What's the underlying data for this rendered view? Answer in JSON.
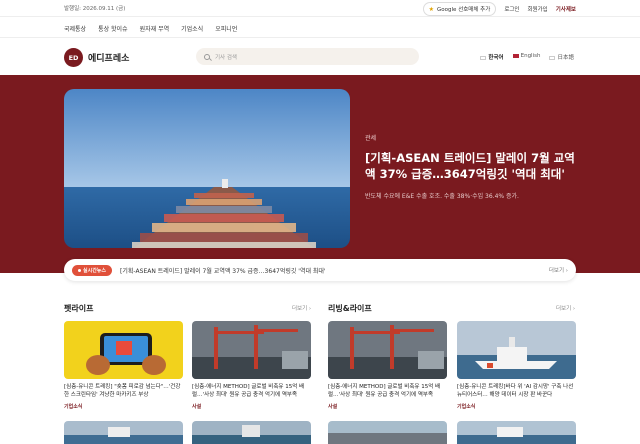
{
  "topbar": {
    "date": "발행일: 2026.09.11 (금)",
    "google_pref": "Google 선호매체 추가",
    "login": "로그인",
    "signup": "회원가입",
    "report": "기사제보"
  },
  "category_nav": [
    "국제통상",
    "통상 핫이슈",
    "원자재 무역",
    "기업소식",
    "오피니언"
  ],
  "header": {
    "logo_mark": "ED",
    "logo_name": "에디프레소",
    "search_placeholder": "기사 검색",
    "languages": [
      "한국어",
      "English",
      "日本語"
    ]
  },
  "hero": {
    "category": "관세",
    "title": "[기획-ASEAN 트레이드] 말레이 7월 교역액 37% 급증…3647억링깃 '역대 최대'",
    "summary": "반도체 수요에 E&E 수출 호조. 수출 38%·수입 36.4% 증가."
  },
  "breaking": {
    "badge": "실시간뉴스",
    "headline": "[기획-ASEAN 트레이드] 말레이 7월 교역액 37% 급증…3647억링깃 '역대 최대'",
    "more": "더보기 ›"
  },
  "sections": [
    {
      "title": "펫라이프",
      "more": "더보기 ›"
    },
    {
      "title": "리빙&라이프",
      "more": "더보기 ›"
    }
  ],
  "cards": [
    {
      "title": "[심층-유니콘 트레킹] \"숏폼 피로감 넘는다\"…'건강한 스크린타임' 겨냥한 마카키즈 부상",
      "category": "기업소식"
    },
    {
      "title": "[심층-에너지 METHOD] 글로벌 비축유 15억 배럴…'사상 최대' 원유 공급 충격 억기에 역부족",
      "category": "사설"
    },
    {
      "title": "[심층-에너지 METHOD] 글로벌 비축유 15억 배럴…'사상 최대' 원유 공급 충격 억기에 역부족",
      "category": "사설"
    },
    {
      "title": "[심층-유니콘 트레킹]바다 위 'AI 감시망' 구축 나선 뉴티어스터… 해양 데이터 시장 판 바꾼다",
      "category": "기업소식"
    }
  ],
  "colors": {
    "brand": "#7a1a1f",
    "badge": "#e0503a"
  }
}
